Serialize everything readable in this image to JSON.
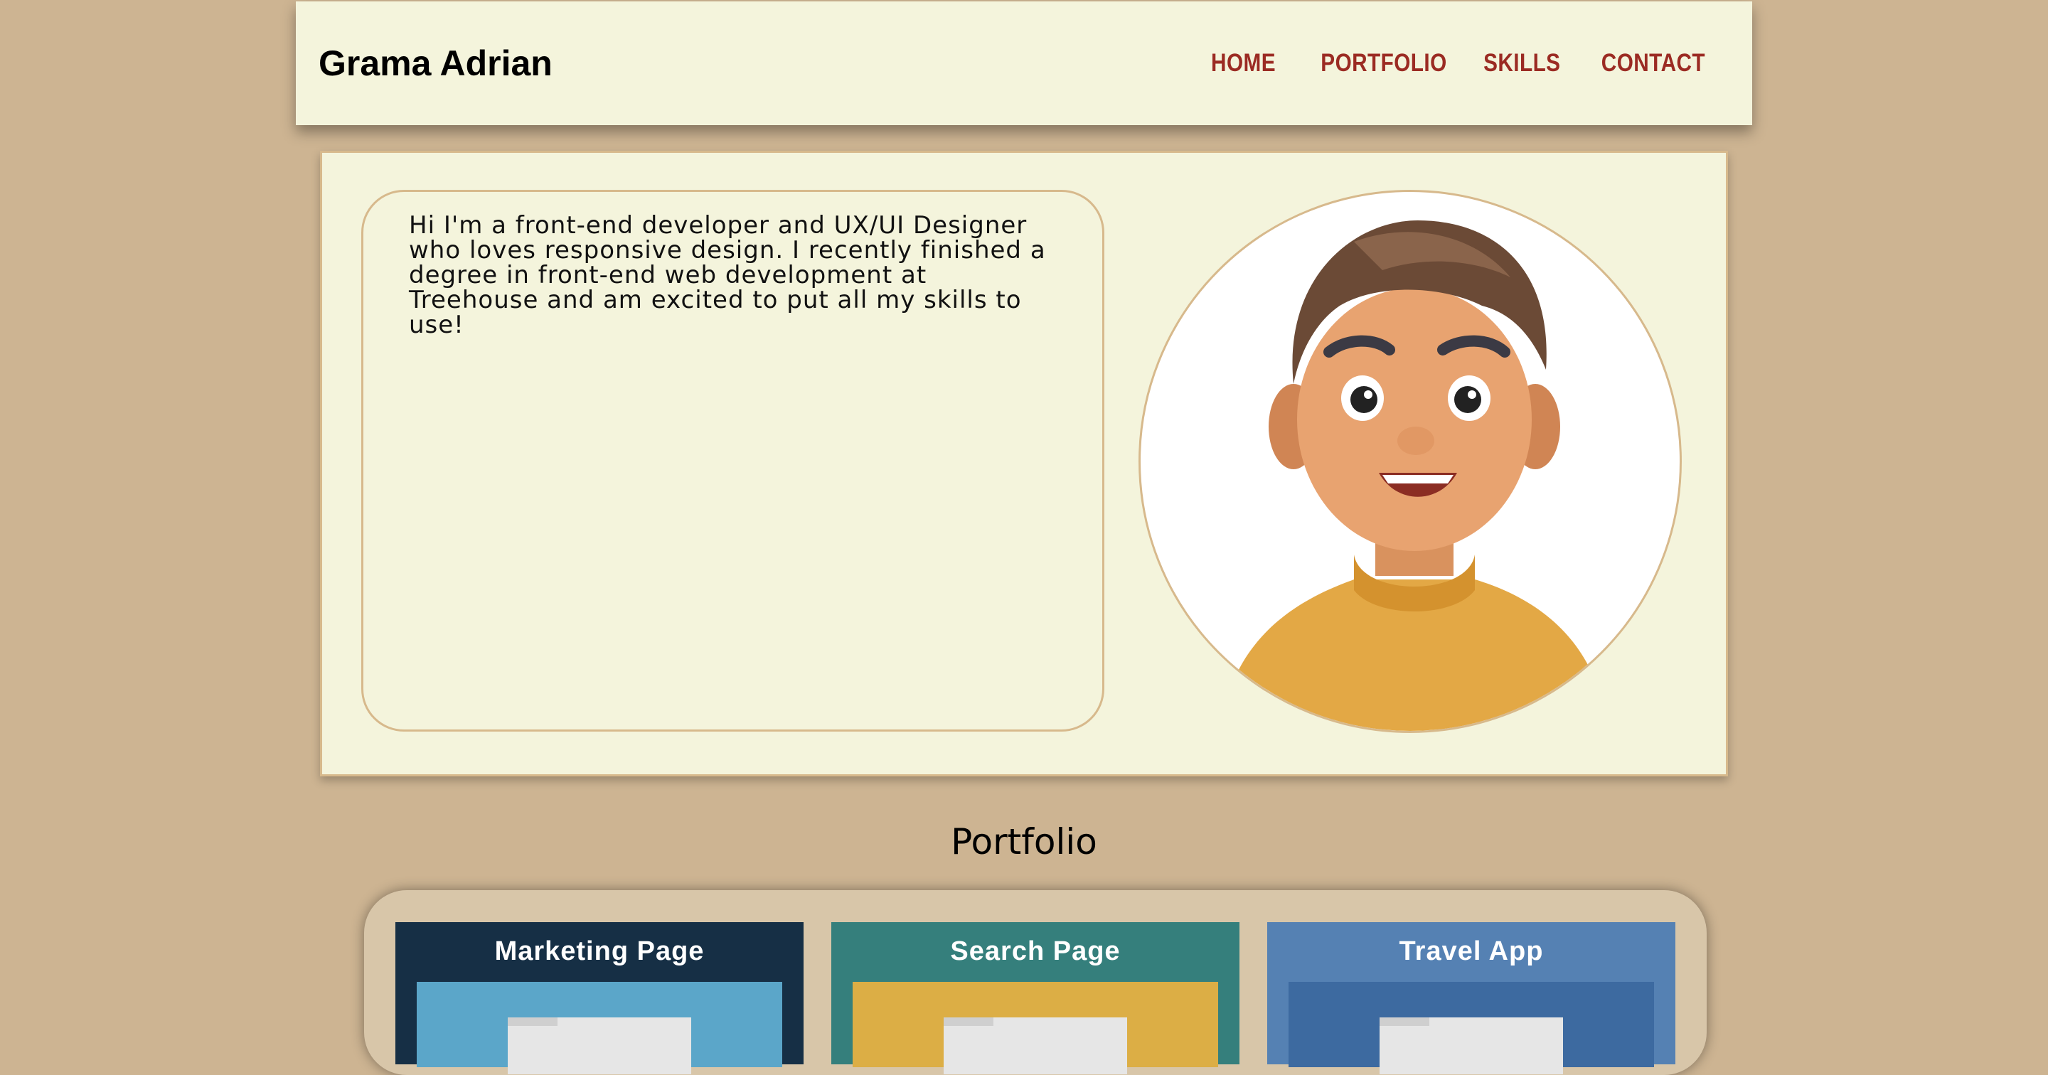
{
  "header": {
    "logo": "Grama Adrian",
    "nav": [
      "HOME",
      "PORTFOLIO",
      "SKILLS",
      "CONTACT"
    ]
  },
  "hero": {
    "bio": "Hi I'm a front-end developer and UX/UI Designer who loves responsive design. I recently finished a degree in front-end web development at Treehouse and am excited to put all my skills to use!"
  },
  "portfolio": {
    "title": "Portfolio",
    "cards": [
      {
        "title": "Marketing Page",
        "color": "#162f45",
        "image_color": "#5ba6c9"
      },
      {
        "title": "Search Page",
        "color": "#357f7c",
        "image_color": "#dcae45"
      },
      {
        "title": "Travel App",
        "color": "#5581b3",
        "image_color": "#3d6aa0"
      }
    ]
  },
  "colors": {
    "background": "#cdb492",
    "panel": "#f4f4dc",
    "accent_border": "#d7b98c",
    "nav_link": "#9b2b23"
  }
}
